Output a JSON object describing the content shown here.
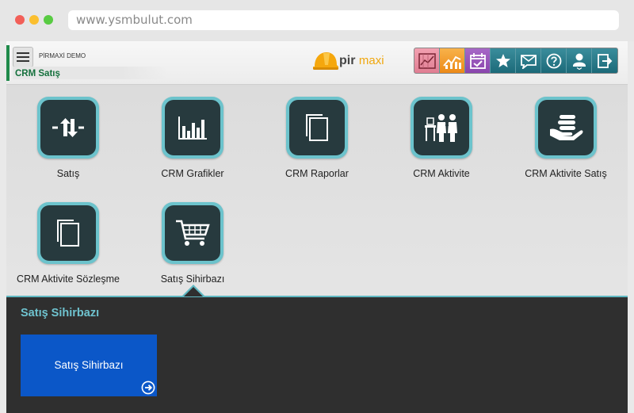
{
  "browser": {
    "url": "www.ysmbulut.com"
  },
  "header": {
    "company": "PİRMAXİ DEMO",
    "module_title": "CRM Satış",
    "logo_pir": "pir",
    "logo_maxi": "maxi"
  },
  "toolbar": {
    "icons": [
      "chart-icon",
      "trend-icon",
      "calendar-icon",
      "star-icon",
      "message-icon",
      "help-icon",
      "user-icon",
      "logout-icon"
    ]
  },
  "modules": [
    {
      "label": "Satış",
      "icon": "exchange-icon"
    },
    {
      "label": "CRM Grafikler",
      "icon": "bar-chart-icon"
    },
    {
      "label": "CRM Raporlar",
      "icon": "document-icon"
    },
    {
      "label": "CRM Aktivite",
      "icon": "meeting-icon"
    },
    {
      "label": "CRM Aktivite Satış",
      "icon": "coins-hand-icon"
    },
    {
      "label": "CRM Aktivite Sözleşme",
      "icon": "document-icon"
    },
    {
      "label": "Satış Sihirbazı",
      "icon": "cart-icon"
    }
  ],
  "panel": {
    "title": "Satış Sihirbazı",
    "cards": [
      {
        "label": "Satış Sihirbazı",
        "color": "#0b57c8"
      }
    ]
  },
  "colors": {
    "accent": "#6fc3cf",
    "brand_green": "#14703c",
    "card_blue": "#0b57c8"
  }
}
